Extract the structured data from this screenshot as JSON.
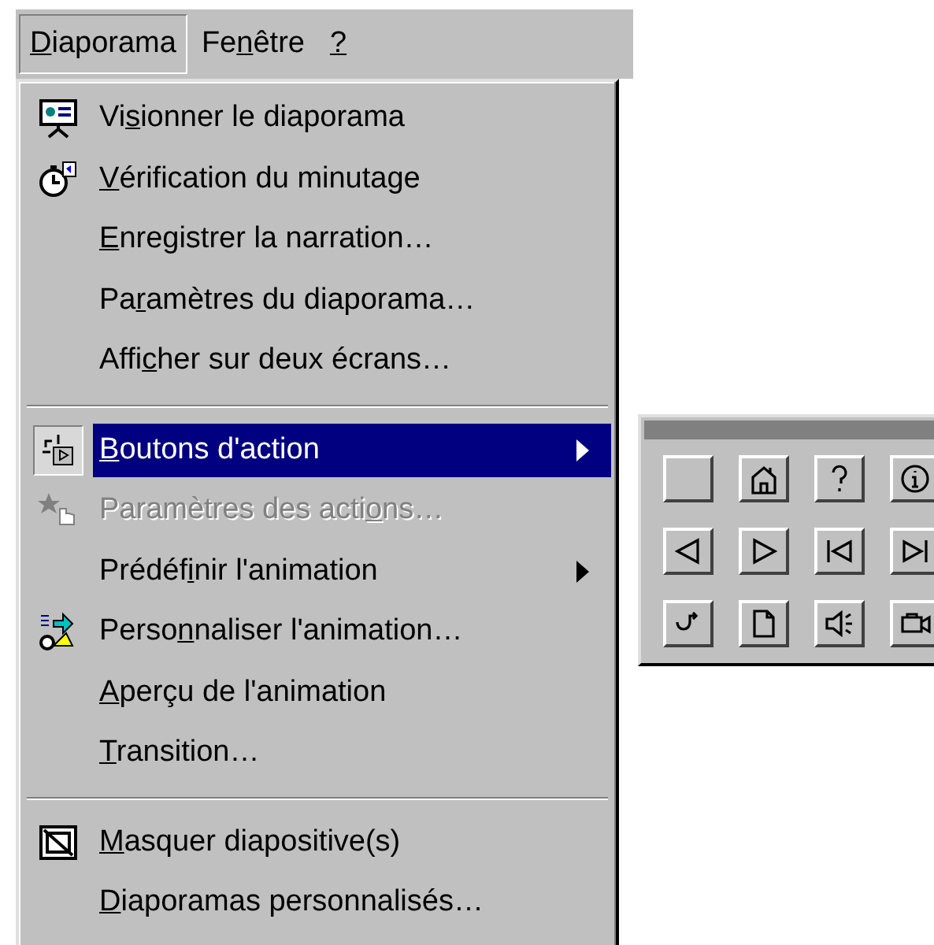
{
  "menubar": [
    {
      "label": {
        "key": "D",
        "after": "iaporama"
      },
      "selected": true
    },
    {
      "label": {
        "before": "Fe",
        "key": "n",
        "after": "être"
      },
      "selected": false
    },
    {
      "label": {
        "key": "?"
      },
      "selected": false
    }
  ],
  "menu": [
    {
      "kind": "item",
      "label": {
        "before": "Vi",
        "key": "s",
        "after": "ionner le diaporama"
      },
      "selected": false,
      "disabled": false,
      "submenu": false
    },
    {
      "kind": "item",
      "label": {
        "key": "V",
        "after": "érification du minutage"
      },
      "selected": false,
      "disabled": false,
      "submenu": false
    },
    {
      "kind": "item",
      "label": {
        "key": "E",
        "after": "nregistrer la narration…"
      },
      "selected": false,
      "disabled": false,
      "submenu": false
    },
    {
      "kind": "item",
      "label": {
        "before": "Pa",
        "key": "r",
        "after": "amètres du diaporama…"
      },
      "selected": false,
      "disabled": false,
      "submenu": false
    },
    {
      "kind": "item",
      "label": {
        "before": "Affi",
        "key": "c",
        "after": "her sur deux écrans…"
      },
      "selected": false,
      "disabled": false,
      "submenu": false
    },
    {
      "kind": "separator"
    },
    {
      "kind": "item",
      "label": {
        "key": "B",
        "after": "outons d'action"
      },
      "selected": true,
      "disabled": false,
      "submenu": true
    },
    {
      "kind": "item",
      "label": {
        "before": "Paramètres des acti",
        "key": "o",
        "after": "ns…"
      },
      "selected": false,
      "disabled": true,
      "submenu": false
    },
    {
      "kind": "item",
      "label": {
        "before": "Prédéf",
        "key": "i",
        "after": "nir l'animation"
      },
      "selected": false,
      "disabled": false,
      "submenu": true
    },
    {
      "kind": "item",
      "label": {
        "before": "Perso",
        "key": "n",
        "after": "naliser l'animation…"
      },
      "selected": false,
      "disabled": false,
      "submenu": false
    },
    {
      "kind": "item",
      "label": {
        "key": "A",
        "after": "perçu de l'animation"
      },
      "selected": false,
      "disabled": false,
      "submenu": false
    },
    {
      "kind": "item",
      "label": {
        "key": "T",
        "after": "ransition…"
      },
      "selected": false,
      "disabled": false,
      "submenu": false
    },
    {
      "kind": "separator"
    },
    {
      "kind": "item",
      "label": {
        "key": "M",
        "after": "asquer diapositive(s)"
      },
      "selected": false,
      "disabled": false,
      "submenu": false
    },
    {
      "kind": "item",
      "label": {
        "key": "D",
        "after": "iaporamas personnalisés…"
      },
      "selected": false,
      "disabled": false,
      "submenu": false
    }
  ]
}
